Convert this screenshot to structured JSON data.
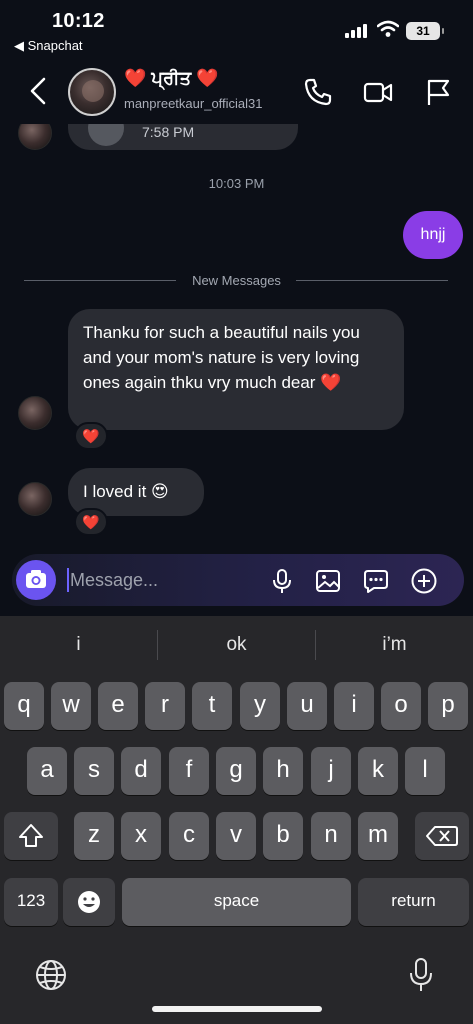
{
  "status_bar": {
    "time": "10:12",
    "back_app": "◀ Snapchat",
    "battery": "31"
  },
  "header": {
    "contact_name": "❤️ ਪ੍ਰੀਤ ❤️",
    "username": "manpreetkaur_official31"
  },
  "chat": {
    "partial_prev": "7:58 PM",
    "timestamp": "10:03 PM",
    "outgoing": [
      {
        "text": "hnjj"
      }
    ],
    "new_messages_label": "New Messages",
    "incoming": [
      {
        "text": "Thanku for such a beautiful nails you and your mom's nature is very loving ones again thku vry much dear ❤️",
        "reaction": "❤️"
      },
      {
        "text": "I loved it 😍",
        "reaction": "❤️"
      }
    ]
  },
  "composer": {
    "placeholder": "Message..."
  },
  "keyboard": {
    "suggestions": [
      "i",
      "ok",
      "i’m"
    ],
    "row1": [
      "q",
      "w",
      "e",
      "r",
      "t",
      "y",
      "u",
      "i",
      "o",
      "p"
    ],
    "row2": [
      "a",
      "s",
      "d",
      "f",
      "g",
      "h",
      "j",
      "k",
      "l"
    ],
    "row3": [
      "z",
      "x",
      "c",
      "v",
      "b",
      "n",
      "m"
    ],
    "numbers_key": "123",
    "space_key": "space",
    "return_key": "return"
  },
  "colors": {
    "background": "#0c0f17",
    "outgoing_bubble": "#8a3de6",
    "incoming_bubble": "#2a2c33",
    "camera_button": "#6b54f0",
    "keyboard_bg": "#27272a"
  }
}
